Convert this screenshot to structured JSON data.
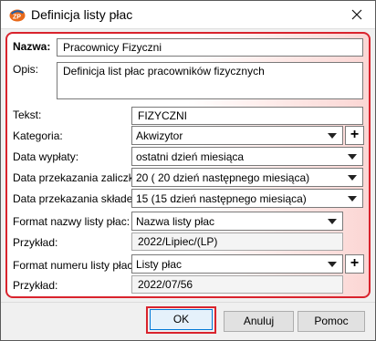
{
  "window": {
    "title": "Definicja listy płac",
    "close_glyph": "✕"
  },
  "form": {
    "name": {
      "label": "Nazwa:",
      "value": "Pracownicy Fizyczni"
    },
    "description": {
      "label": "Opis:",
      "value": "Definicja list płac pracowników fizycznych"
    },
    "text": {
      "label": "Tekst:",
      "value": "FIZYCZNI"
    },
    "category": {
      "label": "Kategoria:",
      "value": "Akwizytor",
      "plus": "+"
    },
    "payout_date": {
      "label": "Data wypłaty:",
      "value": "ostatni dzień miesiąca"
    },
    "tax_advance_date": {
      "label": "Data przekazania zaliczki:",
      "value": "20 ( 20 dzień następnego miesiąca)"
    },
    "contribution_date": {
      "label": "Data przekazania składek:",
      "value": "15 (15 dzień następnego miesiąca)"
    },
    "name_format": {
      "label": "Format nazwy listy płac:",
      "value": "Nazwa listy płac"
    },
    "name_example": {
      "label": "Przykład:",
      "value": "2022/Lipiec/(LP)"
    },
    "number_format": {
      "label": "Format numeru listy płac:",
      "value": "Listy płac",
      "plus": "+"
    },
    "number_example": {
      "label": "Przykład:",
      "value": "2022/07/56"
    }
  },
  "buttons": {
    "ok": "OK",
    "cancel": "Anuluj",
    "help": "Pomoc"
  },
  "colors": {
    "highlight": "#d9232d",
    "icon_orange": "#e8691a",
    "icon_blue": "#1f5fa8"
  }
}
